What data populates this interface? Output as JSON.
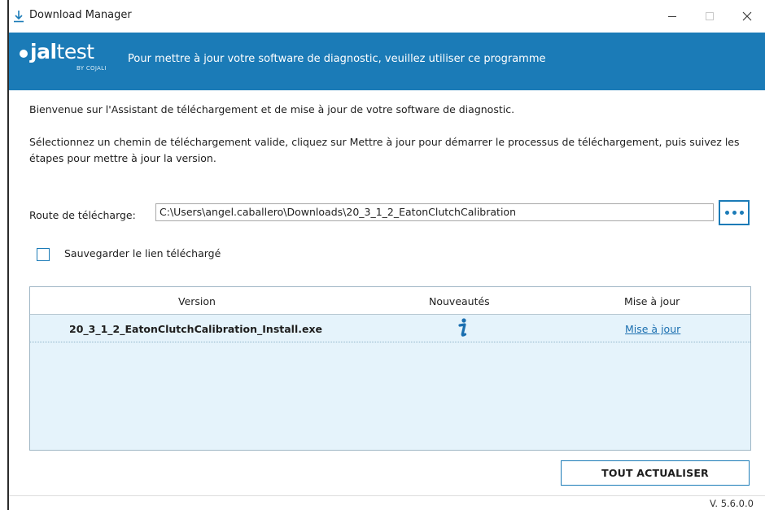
{
  "window": {
    "title": "Download Manager",
    "app_icon": "download-arrow-icon",
    "controls": [
      "minimize-icon",
      "maximize-icon",
      "close-icon"
    ]
  },
  "banner": {
    "logo_primary": "jal",
    "logo_secondary": "test",
    "logo_by": "BY COJALI",
    "message": "Pour mettre à jour votre software de diagnostic, veuillez utiliser ce programme",
    "background_color": "#1b7bb7"
  },
  "intro_text": "Bienvenue sur l'Assistant de téléchargement et de mise à jour de votre software de diagnostic.",
  "instructions_text": "Sélectionnez un chemin de téléchargement valide, cliquez sur Mettre à jour pour démarrer le processus de téléchargement, puis suivez les étapes pour mettre à jour la version.",
  "route": {
    "label": "Route de télécharge:",
    "value": "C:\\Users\\angel.caballero\\Downloads\\20_3_1_2_EatonClutchCalibration",
    "browse_icon": "ellipsis-icon"
  },
  "save_link": {
    "label": "Sauvegarder le lien téléchargé",
    "checked": false
  },
  "table": {
    "columns": [
      "Version",
      "Nouveautés",
      "Mise à jour"
    ],
    "rows": [
      {
        "version": "20_3_1_2_EatonClutchCalibration_Install.exe",
        "news_icon": "info-icon",
        "update_link": "Mise à jour"
      }
    ]
  },
  "update_all_label": "TOUT ACTUALISER",
  "app_version": "V. 5.6.0.0"
}
